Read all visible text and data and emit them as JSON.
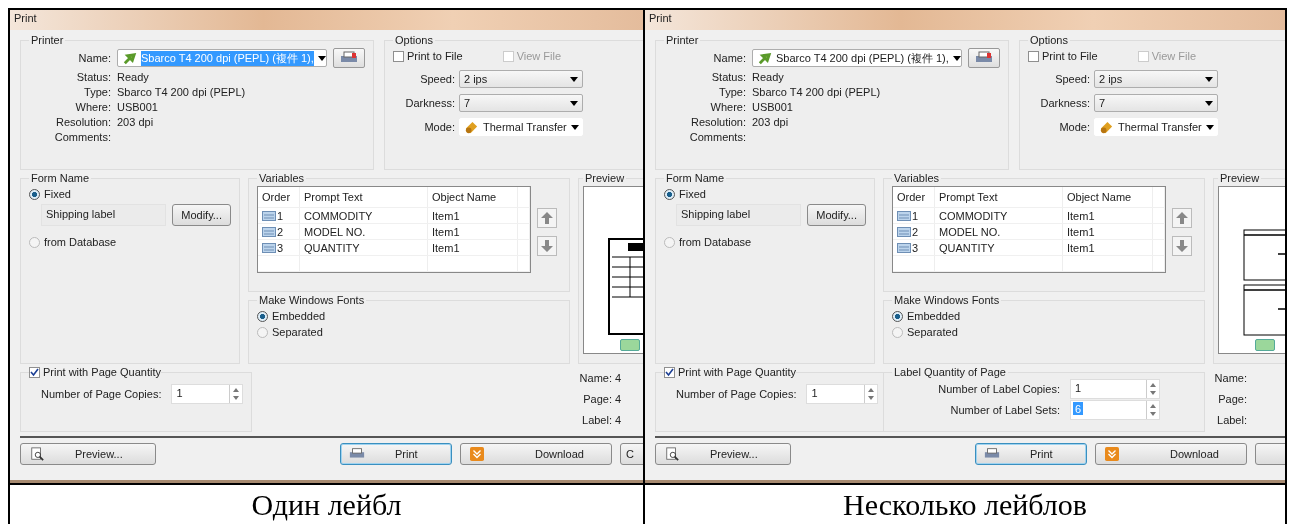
{
  "panels": [
    {
      "title": "Print",
      "printer": {
        "group": "Printer",
        "name_label": "Name:",
        "name_value": "Sbarco T4 200 dpi (PEPL) (複件 1),",
        "name_highlighted": true,
        "fields": [
          {
            "label": "Status:",
            "value": "Ready"
          },
          {
            "label": "Type:",
            "value": "Sbarco T4 200 dpi (PEPL)"
          },
          {
            "label": "Where:",
            "value": "USB001"
          },
          {
            "label": "Resolution:",
            "value": "203 dpi"
          },
          {
            "label": "Comments:"
          }
        ]
      },
      "options": {
        "group": "Options",
        "checks": [
          {
            "label": "Print to File",
            "checked": false,
            "disabled": false
          },
          {
            "label": "View File",
            "checked": false,
            "disabled": true
          }
        ],
        "selects": [
          {
            "label": "Speed:",
            "value": "2  ips",
            "kind": "plain"
          },
          {
            "label": "Darkness:",
            "value": "7",
            "kind": "plain"
          },
          {
            "label": "Mode:",
            "value": "Thermal Transfer",
            "kind": "icon"
          }
        ]
      },
      "form_name": {
        "group": "Form Name",
        "radios": [
          {
            "label": "Fixed",
            "selected": true
          },
          {
            "label": "from Database",
            "selected": false
          }
        ],
        "form_value": "Shipping label",
        "modify": "Modify..."
      },
      "variables": {
        "group": "Variables",
        "columns": [
          "Order",
          "Prompt Text",
          "Object Name"
        ],
        "rows": [
          {
            "order": "1",
            "prompt": "COMMODITY",
            "object": "Item1"
          },
          {
            "order": "2",
            "prompt": "MODEL NO.",
            "object": "Item1"
          },
          {
            "order": "3",
            "prompt": "QUANTITY",
            "object": "Item1"
          }
        ]
      },
      "fonts": {
        "group": "Make Windows Fonts",
        "radios": [
          {
            "label": "Embedded",
            "selected": true
          },
          {
            "label": "Separated",
            "selected": false
          }
        ]
      },
      "page_quantity": {
        "label": "Print with Page Quantity",
        "checked": true,
        "copies_label": "Number of Page Copies:",
        "copies": "1"
      },
      "preview": {
        "group": "Preview",
        "info": [
          {
            "label": "Name:",
            "value": "4"
          },
          {
            "label": "Page:",
            "value": "4"
          },
          {
            "label": "Label:",
            "value": "4"
          }
        ]
      },
      "buttons": [
        {
          "label": "Preview...",
          "kind": "preview"
        },
        {
          "label": "Print",
          "kind": "print"
        },
        {
          "label": "Download",
          "kind": "download"
        },
        {
          "label": "C",
          "kind": "plain"
        }
      ],
      "caption": "Один лейбл"
    },
    {
      "title": "Print",
      "printer": {
        "group": "Printer",
        "name_label": "Name:",
        "name_value": "Sbarco T4 200 dpi (PEPL) (複件 1),",
        "name_highlighted": false,
        "fields": [
          {
            "label": "Status:",
            "value": "Ready"
          },
          {
            "label": "Type:",
            "value": "Sbarco T4 200 dpi (PEPL)"
          },
          {
            "label": "Where:",
            "value": "USB001"
          },
          {
            "label": "Resolution:",
            "value": "203 dpi"
          },
          {
            "label": "Comments:"
          }
        ]
      },
      "options": {
        "group": "Options",
        "checks": [
          {
            "label": "Print to File",
            "checked": false,
            "disabled": false
          },
          {
            "label": "View File",
            "checked": false,
            "disabled": true
          }
        ],
        "selects": [
          {
            "label": "Speed:",
            "value": "2  ips",
            "kind": "plain"
          },
          {
            "label": "Darkness:",
            "value": "7",
            "kind": "plain"
          },
          {
            "label": "Mode:",
            "value": "Thermal Transfer",
            "kind": "icon"
          }
        ]
      },
      "form_name": {
        "group": "Form Name",
        "radios": [
          {
            "label": "Fixed",
            "selected": true
          },
          {
            "label": "from Database",
            "selected": false
          }
        ],
        "form_value": "Shipping label",
        "modify": "Modify..."
      },
      "variables": {
        "group": "Variables",
        "columns": [
          "Order",
          "Prompt Text",
          "Object Name"
        ],
        "rows": [
          {
            "order": "1",
            "prompt": "COMMODITY",
            "object": "Item1"
          },
          {
            "order": "2",
            "prompt": "MODEL NO.",
            "object": "Item1"
          },
          {
            "order": "3",
            "prompt": "QUANTITY",
            "object": "Item1"
          }
        ]
      },
      "fonts": {
        "group": "Make Windows Fonts",
        "radios": [
          {
            "label": "Embedded",
            "selected": true
          },
          {
            "label": "Separated",
            "selected": false
          }
        ]
      },
      "page_quantity": {
        "label": "Print with Page Quantity",
        "checked": true,
        "copies_label": "Number of Page Copies:",
        "copies": "1"
      },
      "label_quantity": {
        "group": "Label Quantity of Page",
        "fields": [
          {
            "label": "Number of Label Copies:",
            "value": "1",
            "highlighted": false
          },
          {
            "label": "Number of Label Sets:",
            "value": "6",
            "highlighted": true
          }
        ]
      },
      "preview": {
        "group": "Preview",
        "info": [
          {
            "label": "Name:"
          },
          {
            "label": "Page:"
          },
          {
            "label": "Label:"
          }
        ]
      },
      "buttons": [
        {
          "label": "Preview...",
          "kind": "preview"
        },
        {
          "label": "Print",
          "kind": "print"
        },
        {
          "label": "Download",
          "kind": "download"
        },
        {
          "kind": "plain"
        }
      ],
      "caption": "Несколько лейблов"
    }
  ]
}
